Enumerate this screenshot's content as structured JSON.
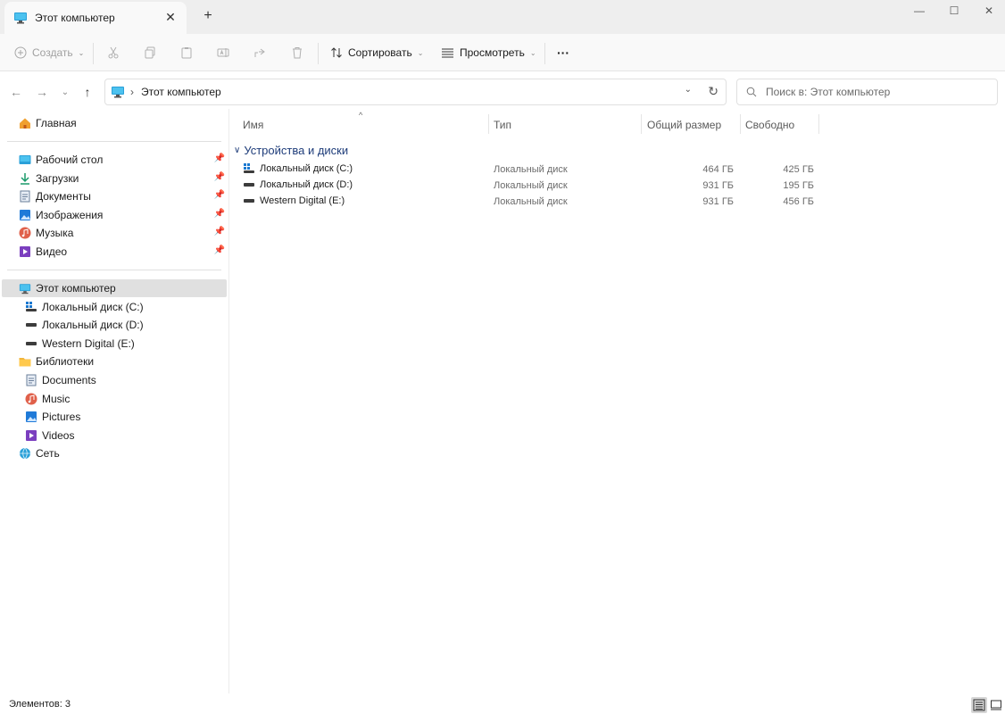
{
  "tab": {
    "title": "Этот компьютер",
    "close_glyph": "✕",
    "new_glyph": "+"
  },
  "window_controls": {
    "minimize": "—",
    "maximize": "☐",
    "close": "✕"
  },
  "toolbar": {
    "create_label": "Создать",
    "sort_label": "Сортировать",
    "view_label": "Просмотреть",
    "more_glyph": "···"
  },
  "address": {
    "crumb": "Этот компьютер",
    "separator": "›"
  },
  "search": {
    "placeholder": "Поиск в: Этот компьютер"
  },
  "sidebar": {
    "home": "Главная",
    "quick": [
      {
        "label": "Рабочий стол",
        "icon": "desktop-icon"
      },
      {
        "label": "Загрузки",
        "icon": "download-icon"
      },
      {
        "label": "Документы",
        "icon": "document-icon"
      },
      {
        "label": "Изображения",
        "icon": "image-icon"
      },
      {
        "label": "Музыка",
        "icon": "music-icon"
      },
      {
        "label": "Видео",
        "icon": "video-icon"
      }
    ],
    "this_pc": "Этот компьютер",
    "drives": [
      {
        "label": "Локальный диск (C:)"
      },
      {
        "label": "Локальный диск (D:)"
      },
      {
        "label": "Western Digital (E:)"
      }
    ],
    "libraries": "Библиотеки",
    "library_items": [
      {
        "label": "Documents"
      },
      {
        "label": "Music"
      },
      {
        "label": "Pictures"
      },
      {
        "label": "Videos"
      }
    ],
    "network": "Сеть"
  },
  "columns": {
    "name": "Имя",
    "type": "Тип",
    "total": "Общий размер",
    "free": "Свободно"
  },
  "group": {
    "title": "Устройства и диски"
  },
  "rows": [
    {
      "name": "Локальный диск (C:)",
      "type": "Локальный диск",
      "total": "464 ГБ",
      "free": "425 ГБ"
    },
    {
      "name": "Локальный диск (D:)",
      "type": "Локальный диск",
      "total": "931 ГБ",
      "free": "195 ГБ"
    },
    {
      "name": "Western Digital (E:)",
      "type": "Локальный диск",
      "total": "931 ГБ",
      "free": "456 ГБ"
    }
  ],
  "status": {
    "items_label": "Элементов: 3"
  },
  "colors": {
    "accent": "#0f6cbd",
    "selected": "#e0e0e0",
    "group_text": "#1f3d7a"
  }
}
